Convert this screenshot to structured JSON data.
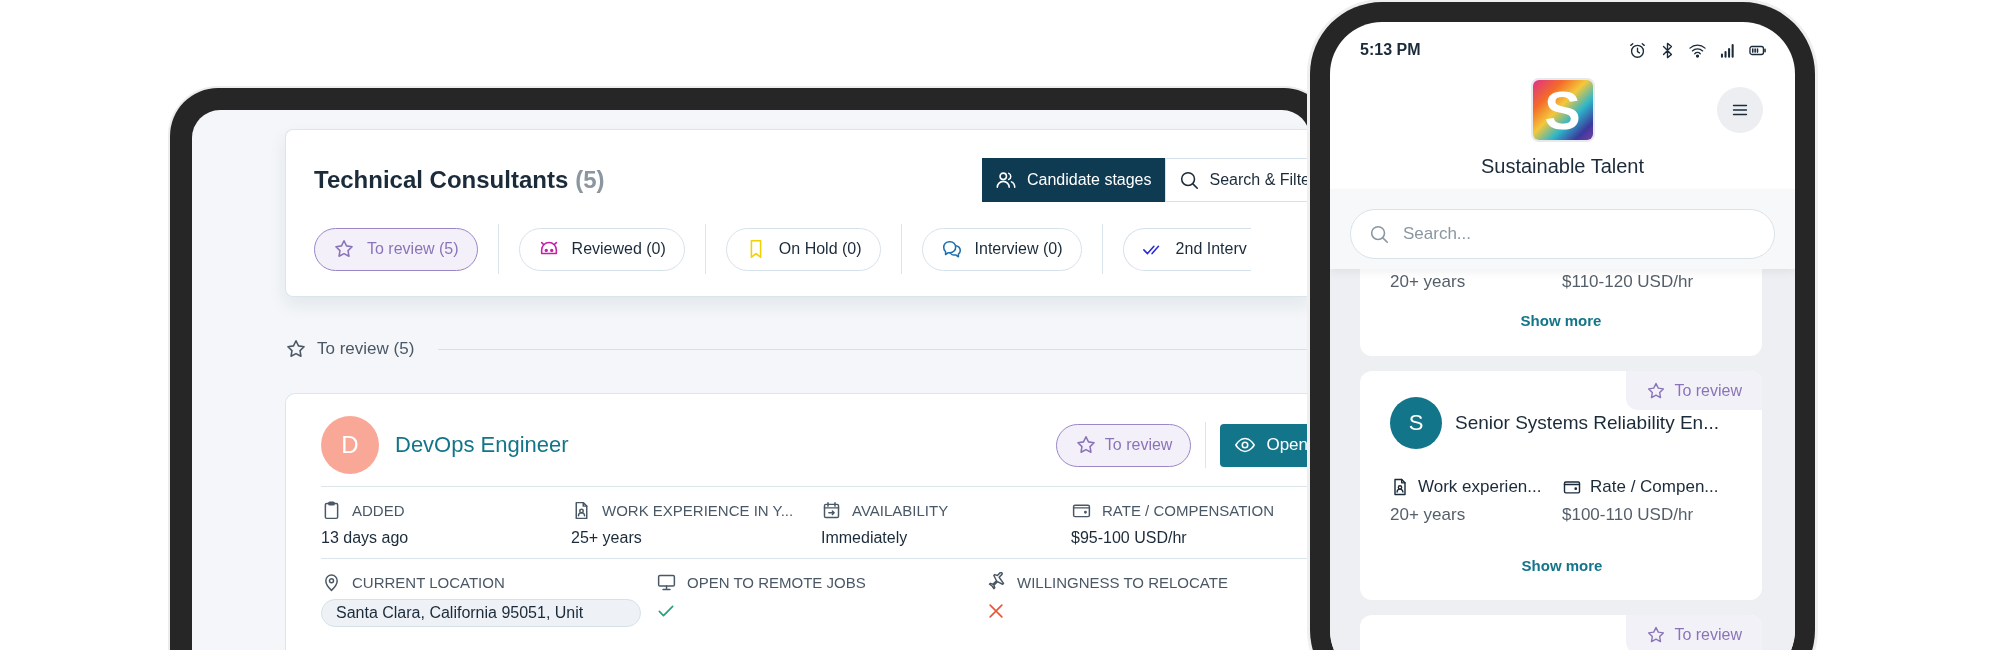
{
  "tablet": {
    "header": {
      "title": "Technical Consultants",
      "count": "(5)",
      "view_buttons": [
        {
          "label": "Candidate stages",
          "selected": true
        },
        {
          "label": "Search & Filte",
          "selected": false
        }
      ],
      "stages": [
        {
          "label": "To review (5)",
          "selected": true
        },
        {
          "label": "Reviewed (0)",
          "selected": false
        },
        {
          "label": "On Hold (0)",
          "selected": false
        },
        {
          "label": "Interview (0)",
          "selected": false
        },
        {
          "label": "2nd Interv",
          "selected": false
        }
      ]
    },
    "section": {
      "label": "To review (5)"
    },
    "candidate": {
      "avatar": "D",
      "color": "#f9a898",
      "title": "DevOps Engineer",
      "status": "To review",
      "open_button": "Open",
      "fields": [
        {
          "label": "ADDED",
          "value": "13 days ago"
        },
        {
          "label": "WORK EXPERIENCE IN Y...",
          "value": "25+ years"
        },
        {
          "label": "AVAILABILITY",
          "value": "Immediately"
        },
        {
          "label": "RATE / COMPENSATION",
          "value": "$95-100 USD/hr"
        }
      ],
      "details": [
        {
          "kind": "chip",
          "label": "CURRENT LOCATION",
          "value": "Santa Clara, California 95051, Unit"
        },
        {
          "kind": "flag",
          "label": "OPEN TO REMOTE JOBS",
          "on": true
        },
        {
          "kind": "flag",
          "label": "WILLINGNESS TO RELOCATE",
          "on": false
        }
      ]
    }
  },
  "phone": {
    "status_bar": {
      "time": "5:13 PM"
    },
    "logo_letter": "S",
    "app_title": "Sustainable Talent",
    "search": {
      "placeholder": "Search..."
    },
    "cards": [
      {
        "kind": "tail",
        "values": [
          "20+ years",
          "$110-120 USD/hr"
        ],
        "show_more": "Show more"
      },
      {
        "kind": "full",
        "status": "To review",
        "avatar": "S",
        "color": "#13758a",
        "title": "Senior Systems Reliability En...",
        "fields": [
          {
            "label": "Work experien...",
            "value": "20+ years"
          },
          {
            "label": "Rate / Compen...",
            "value": "$100-110 USD/hr"
          }
        ],
        "show_more": "Show more"
      },
      {
        "kind": "head",
        "status": "To review"
      }
    ]
  }
}
